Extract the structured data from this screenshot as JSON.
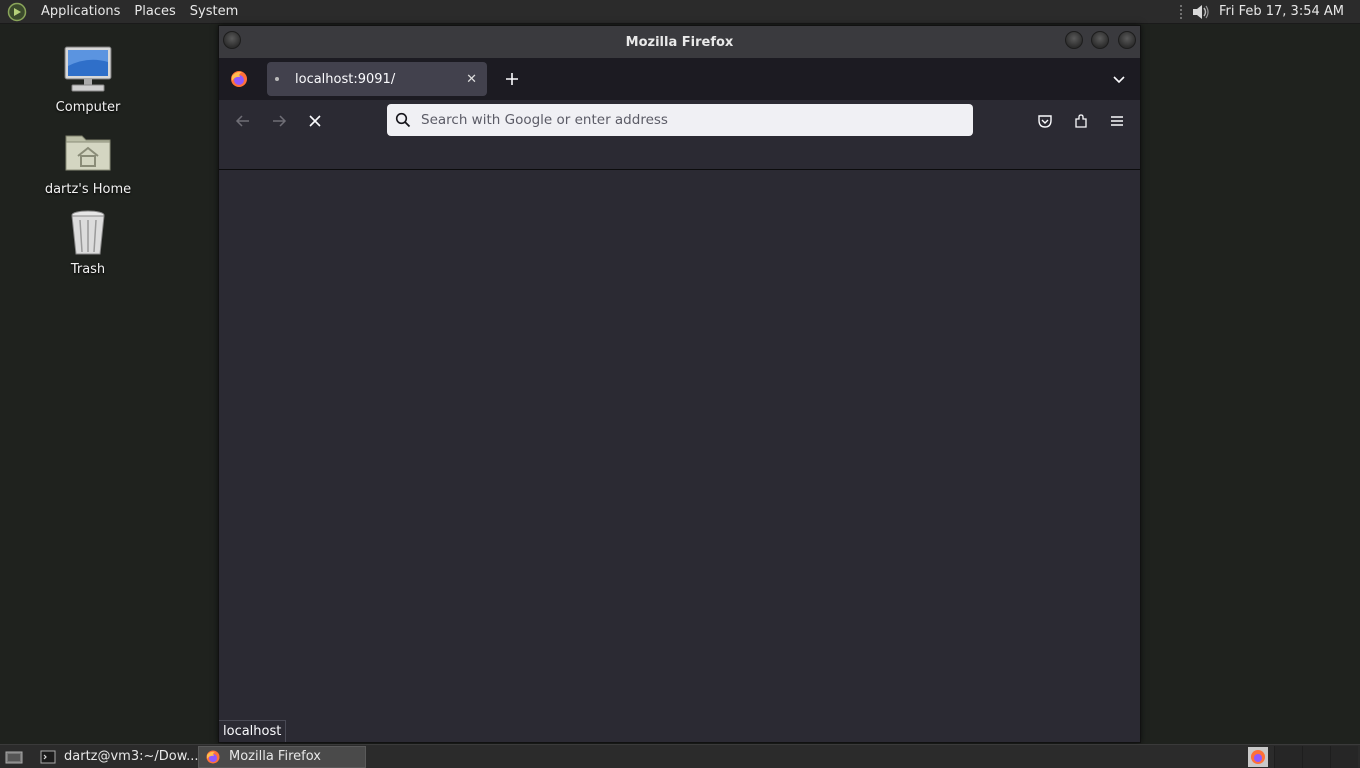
{
  "top_panel": {
    "menus": [
      "Applications",
      "Places",
      "System"
    ],
    "clock": "Fri Feb 17,  3:54 AM"
  },
  "desktop": {
    "icons": [
      {
        "label": "Computer",
        "icon": "computer-icon"
      },
      {
        "label": "dartz's Home",
        "icon": "home-folder-icon"
      },
      {
        "label": "Trash",
        "icon": "trash-icon"
      }
    ]
  },
  "firefox": {
    "window_title": "Mozilla Firefox",
    "tab": {
      "title": "localhost:9091/"
    },
    "urlbar": {
      "placeholder": "Search with Google or enter address",
      "value": ""
    },
    "status_text": "localhost"
  },
  "taskbar": {
    "tasks": [
      {
        "label": "dartz@vm3:~/Dow...",
        "icon": "terminal-icon"
      },
      {
        "label": "Mozilla Firefox",
        "icon": "firefox-icon"
      }
    ]
  },
  "colors": {
    "firefox_bg": "#2b2a33",
    "tabbar_bg": "#1c1b22",
    "active_tab": "#42414d",
    "panel_bg": "#2b2b2b",
    "desktop_bg": "#1f221e"
  }
}
